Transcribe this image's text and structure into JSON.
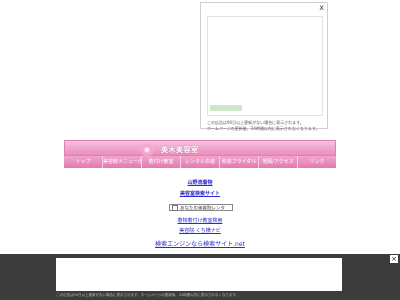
{
  "top_ad": {
    "close_label": "x",
    "badge": "",
    "note_line1": "この広告は90日以上更新がない場合に表示されます。",
    "note_line2": "ホームページの更新後、24時間以内に表示されなくなります。"
  },
  "header": {
    "small_text": "",
    "title": "美木美容室"
  },
  "nav": {
    "items": [
      "トップ",
      "美容館メニュー/価格",
      "着付け教室",
      "レンタル衣装",
      "和装ブライダル",
      "地図/アクセス",
      "リンク"
    ]
  },
  "links": {
    "link1": "山野流着物",
    "link2": "美容室検索サイト",
    "search_label": "あなたの美容院レンタ",
    "link3": "着物着付け教室検索",
    "link4": "美容院 くち横ナビ",
    "link5": "検索エンジンなら検索サイト.net"
  },
  "bottom_ad": {
    "close_label": "×",
    "note": "この広告は90日以上更新がない場合に表示されます。ホームページの更新後、24時間以内に表示されなくなります。"
  }
}
